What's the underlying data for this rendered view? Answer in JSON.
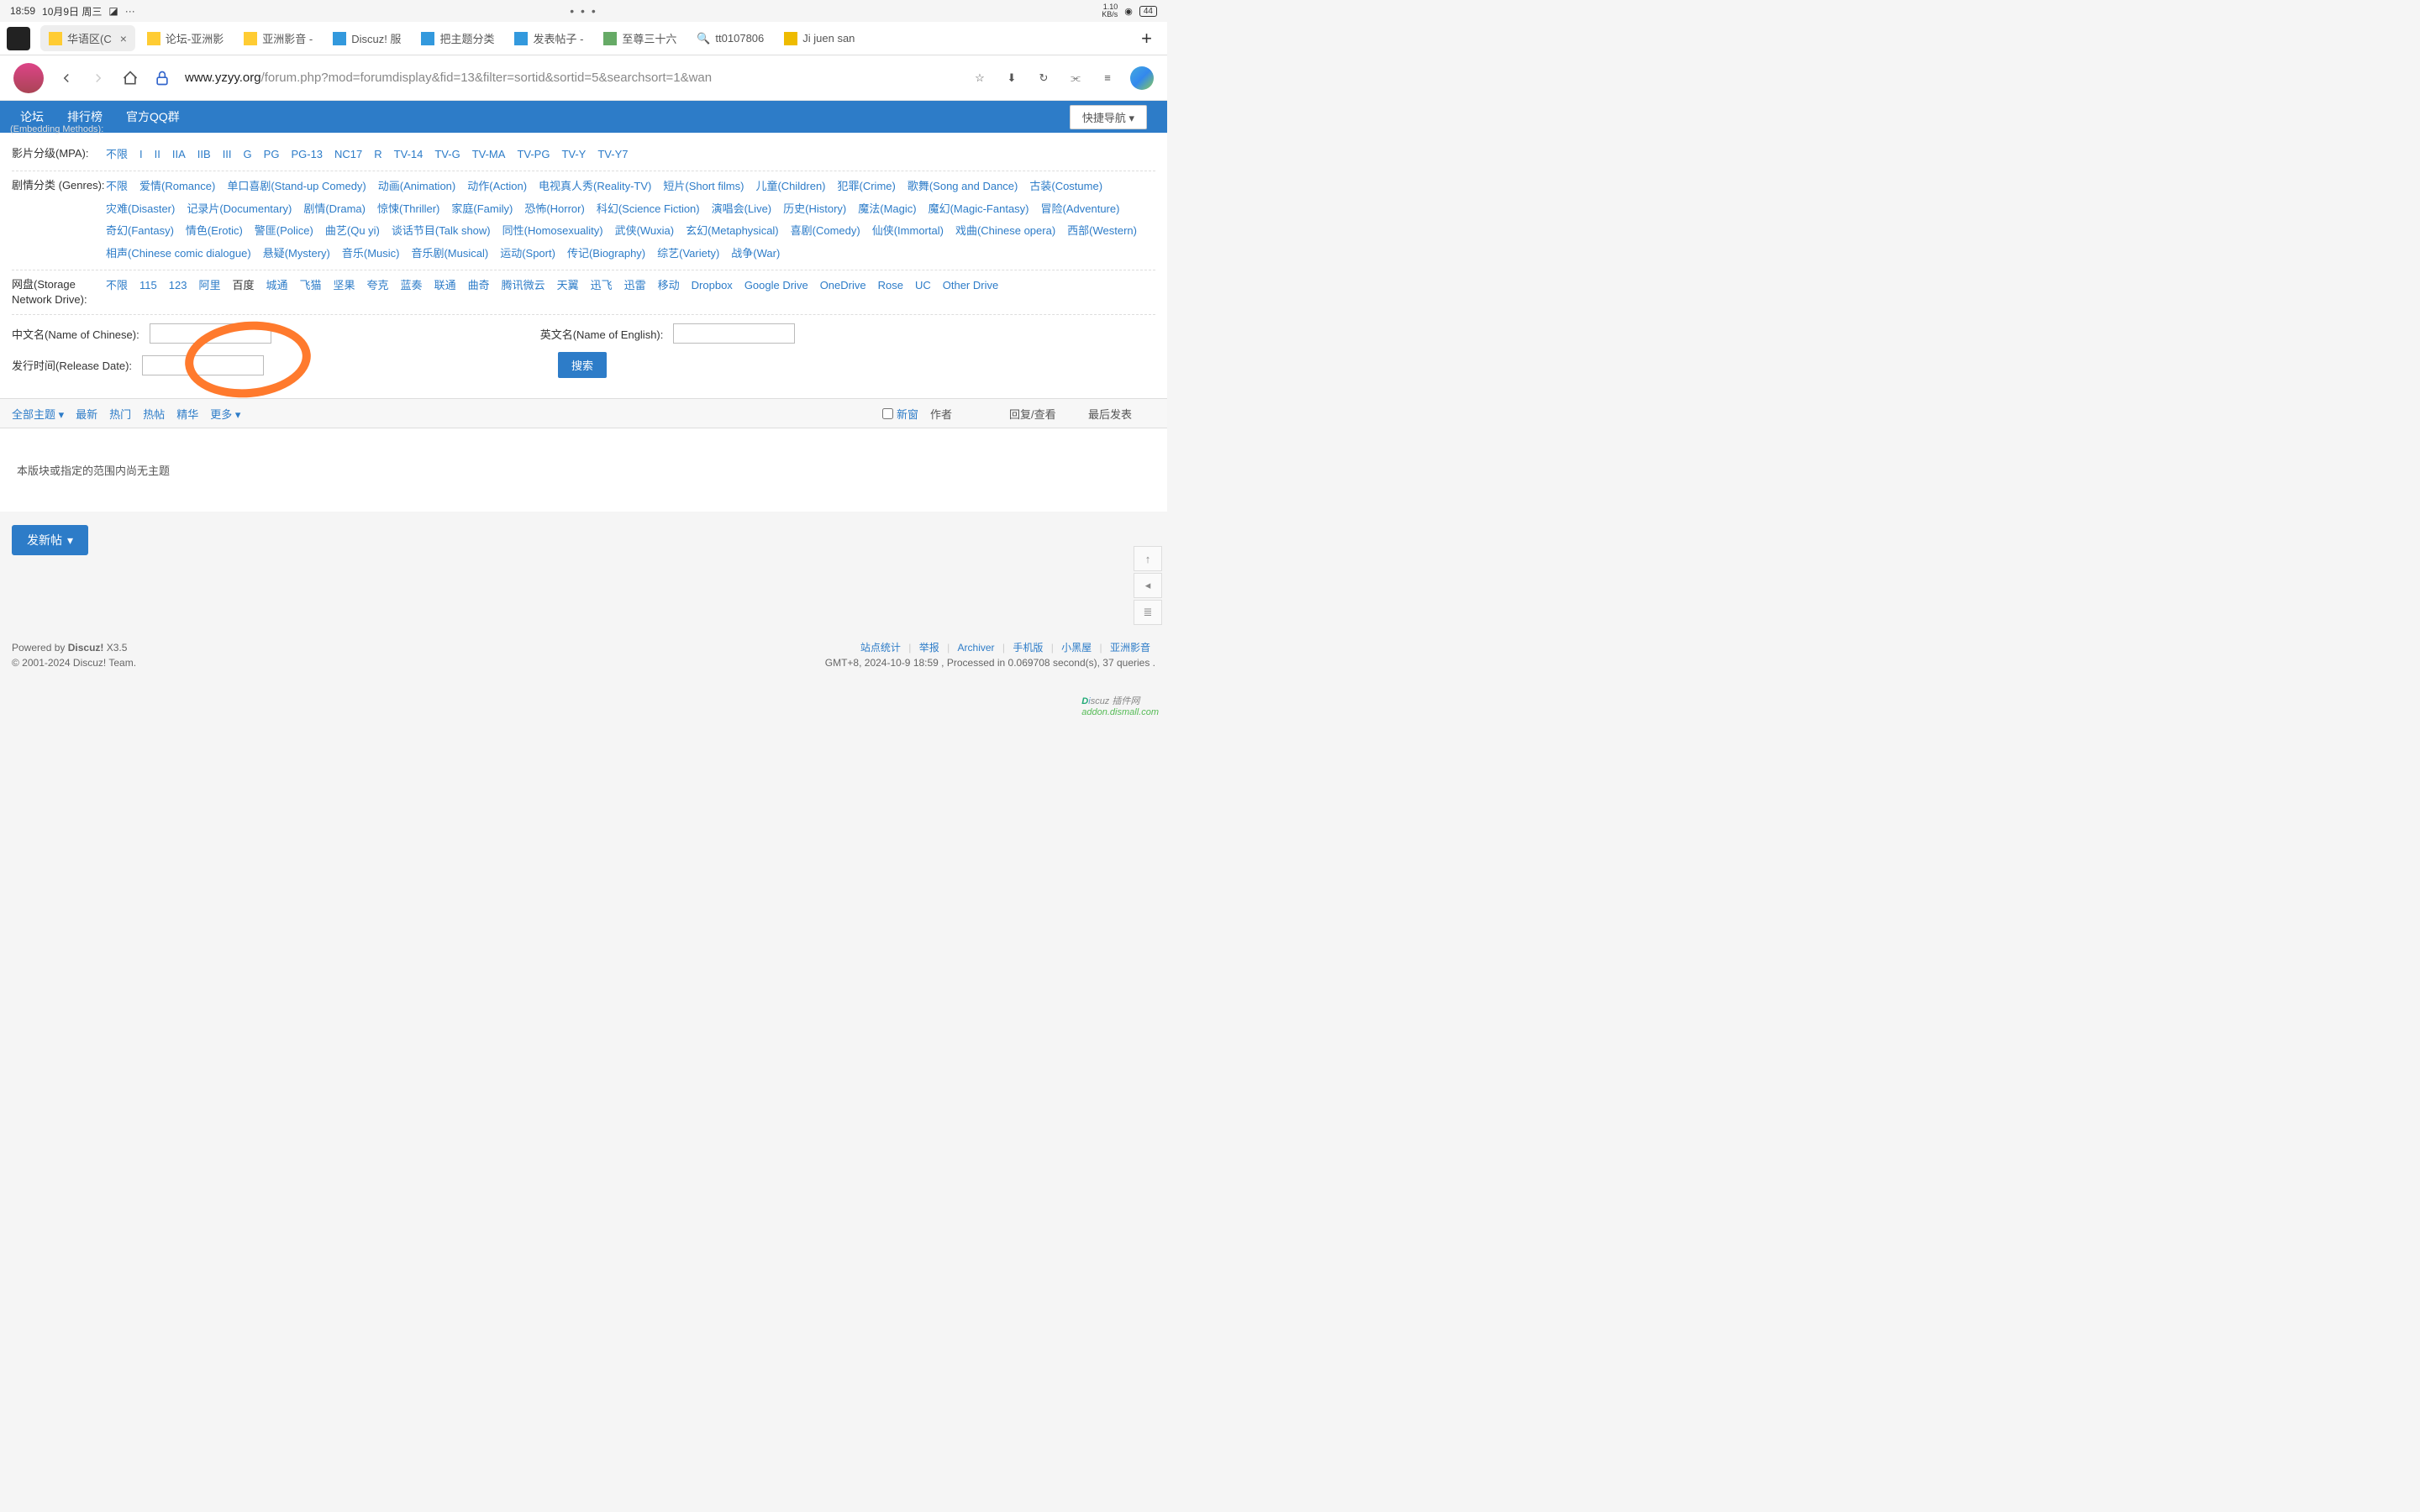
{
  "status": {
    "time": "18:59",
    "date": "10月9日 周三",
    "dots": "···",
    "center_dots": "• • •",
    "speed": "1.10\nKB/s",
    "battery": "44"
  },
  "browser": {
    "tabs": [
      {
        "label": "华语区(C",
        "active": true
      },
      {
        "label": "论坛-亚洲影"
      },
      {
        "label": "亚洲影音 -"
      },
      {
        "label": "Discuz! 服"
      },
      {
        "label": "把主题分类"
      },
      {
        "label": "发表帖子 -"
      },
      {
        "label": "至尊三十六"
      },
      {
        "label": "tt0107806"
      },
      {
        "label": "Ji juen san"
      }
    ],
    "url_host": "www.yzyy.org",
    "url_path": "/forum.php?mod=forumdisplay&fid=13&filter=sortid&sortid=5&searchsort=1&wan"
  },
  "nav": {
    "items": [
      "论坛",
      "排行榜",
      "官方QQ群"
    ],
    "quick": "快捷导航"
  },
  "embed_label": "(Embedding Methods):",
  "filters": {
    "mpa": {
      "label": "影片分级(MPA):",
      "options": [
        "不限",
        "I",
        "II",
        "IIA",
        "IIB",
        "III",
        "G",
        "PG",
        "PG-13",
        "NC17",
        "R",
        "TV-14",
        "TV-G",
        "TV-MA",
        "TV-PG",
        "TV-Y",
        "TV-Y7"
      ]
    },
    "genres": {
      "label": "剧情分类 (Genres):",
      "options": [
        "不限",
        "爱情(Romance)",
        "单口喜剧(Stand-up Comedy)",
        "动画(Animation)",
        "动作(Action)",
        "电视真人秀(Reality-TV)",
        "短片(Short films)",
        "儿童(Children)",
        "犯罪(Crime)",
        "歌舞(Song and Dance)",
        "古装(Costume)",
        "灾难(Disaster)",
        "记录片(Documentary)",
        "剧情(Drama)",
        "惊悚(Thriller)",
        "家庭(Family)",
        "恐怖(Horror)",
        "科幻(Science Fiction)",
        "演唱会(Live)",
        "历史(History)",
        "魔法(Magic)",
        "魔幻(Magic-Fantasy)",
        "冒险(Adventure)",
        "奇幻(Fantasy)",
        "情色(Erotic)",
        "警匪(Police)",
        "曲艺(Qu yi)",
        "谈话节目(Talk show)",
        "同性(Homosexuality)",
        "武侠(Wuxia)",
        "玄幻(Metaphysical)",
        "喜剧(Comedy)",
        "仙侠(Immortal)",
        "戏曲(Chinese opera)",
        "西部(Western)",
        "相声(Chinese comic dialogue)",
        "悬疑(Mystery)",
        "音乐(Music)",
        "音乐剧(Musical)",
        "运动(Sport)",
        "传记(Biography)",
        "综艺(Variety)",
        "战争(War)"
      ]
    },
    "drive": {
      "label": "网盘(Storage Network Drive):",
      "options": [
        "不限",
        "115",
        "123",
        "阿里",
        "百度",
        "城通",
        "飞猫",
        "坚果",
        "夸克",
        "蓝奏",
        "联通",
        "曲奇",
        "腾讯微云",
        "天翼",
        "迅飞",
        "迅雷",
        "移动",
        "Dropbox",
        "Google Drive",
        "OneDrive",
        "Rose",
        "UC",
        "Other Drive"
      ],
      "current": "百度"
    }
  },
  "inputs": {
    "cn_label": "中文名(Name of Chinese):",
    "en_label": "英文名(Name of English):",
    "date_label": "发行时间(Release Date):",
    "search": "搜索"
  },
  "thread_header": {
    "all": "全部主题",
    "latest": "最新",
    "hot": "热门",
    "hotpost": "热帖",
    "essence": "精华",
    "more": "更多",
    "newwin": "新窗",
    "author": "作者",
    "reply": "回复/查看",
    "lastpost": "最后发表"
  },
  "empty": "本版块或指定的范围内尚无主题",
  "newpost": "发新帖",
  "footer": {
    "powered": "Powered by",
    "discuz": "Discuz!",
    "ver": "X3.5",
    "copy": "© 2001-2024 Discuz! Team.",
    "links": [
      "站点统计",
      "举报",
      "Archiver",
      "手机版",
      "小黑屋",
      "亚洲影音"
    ],
    "gmt": "GMT+8, 2024-10-9 18:59 , Processed in 0.069708 second(s), 37 queries ."
  },
  "watermark": "addon.dismall.com"
}
